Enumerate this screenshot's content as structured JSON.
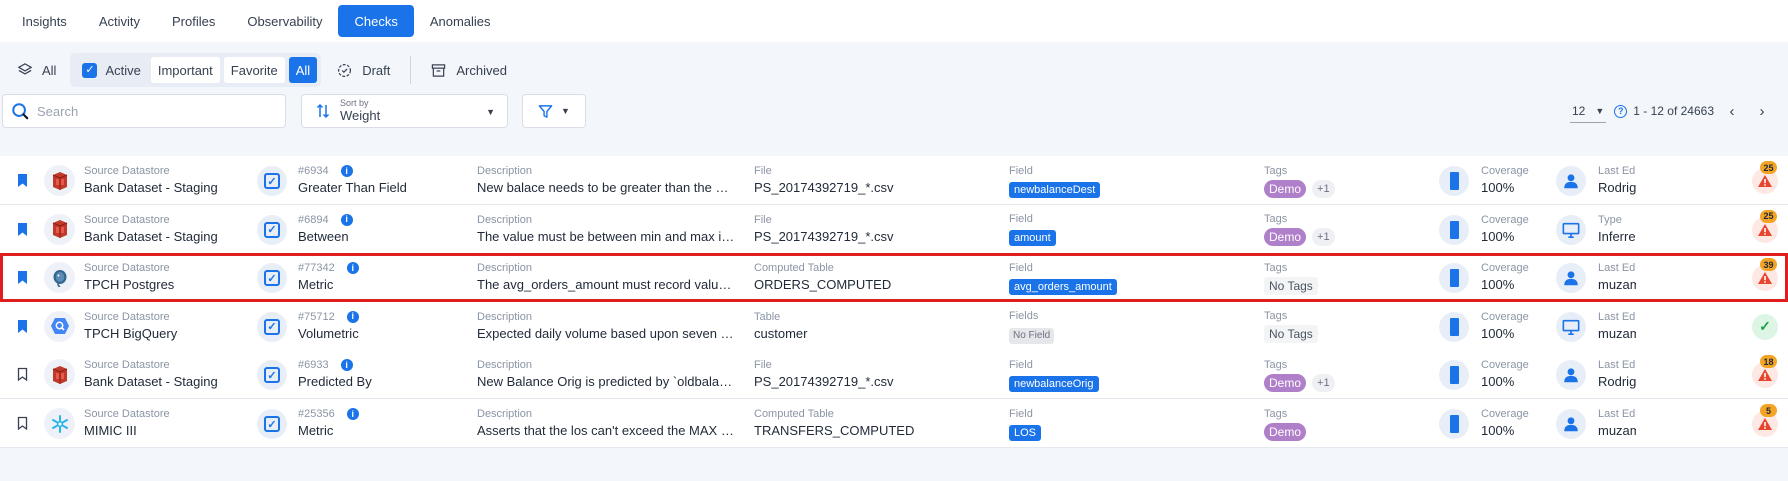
{
  "tabs": [
    {
      "label": "Insights",
      "active": false
    },
    {
      "label": "Activity",
      "active": false
    },
    {
      "label": "Profiles",
      "active": false
    },
    {
      "label": "Observability",
      "active": false
    },
    {
      "label": "Checks",
      "active": true
    },
    {
      "label": "Anomalies",
      "active": false
    }
  ],
  "status_filter": {
    "all_label": "All",
    "active_label": "Active",
    "active_checked": true,
    "important_label": "Important",
    "favorite_label": "Favorite",
    "all_sub_label": "All",
    "draft_label": "Draft",
    "archived_label": "Archived"
  },
  "search": {
    "placeholder": "Search",
    "value": ""
  },
  "sort": {
    "label": "Sort by",
    "value": "Weight"
  },
  "pagination": {
    "per_page": "12",
    "range_text": "1 - 12 of 24663"
  },
  "colors": {
    "accent": "#1a73e8",
    "tag": "#b07fc9",
    "highlight": "#e01e1e",
    "anomaly_badge": "#f4a425",
    "anomaly_alert": "#e8452c",
    "passing": "#1fa34a"
  },
  "rows": [
    {
      "bookmarked": true,
      "highlighted": false,
      "datastore_icon": "red-database-icon",
      "datastore_label": "Source Datastore",
      "datastore": "Bank Dataset - Staging",
      "check_id": "#6934",
      "check_type": "Greater Than Field",
      "desc_label": "Description",
      "description": "New balace needs to be greater than the old b...",
      "container_label": "File",
      "container": "PS_20174392719_*.csv",
      "field_label": "Field",
      "field": "newbalanceDest",
      "field_chip": true,
      "tags_label": "Tags",
      "tag": "Demo",
      "tag_more": "+1",
      "has_tag": true,
      "coverage_label": "Coverage",
      "coverage": "100%",
      "edit_label": "Last Edit",
      "editor": "Rodrigo",
      "editor_icon": "user-icon",
      "anomaly_count": "25",
      "anomaly_state": "alert"
    },
    {
      "bookmarked": true,
      "highlighted": false,
      "datastore_icon": "red-database-icon",
      "datastore_label": "Source Datastore",
      "datastore": "Bank Dataset - Staging",
      "check_id": "#6894",
      "check_type": "Between",
      "desc_label": "Description",
      "description": "The value must be between min and max inclu...",
      "container_label": "File",
      "container": "PS_20174392719_*.csv",
      "field_label": "Field",
      "field": "amount",
      "field_chip": true,
      "tags_label": "Tags",
      "tag": "Demo",
      "tag_more": "+1",
      "has_tag": true,
      "coverage_label": "Coverage",
      "coverage": "100%",
      "edit_label": "Type",
      "editor": "Inferred",
      "editor_icon": "monitor-icon",
      "anomaly_count": "25",
      "anomaly_state": "alert"
    },
    {
      "bookmarked": true,
      "highlighted": true,
      "datastore_icon": "postgres-icon",
      "datastore_label": "Source Datastore",
      "datastore": "TPCH Postgres",
      "check_id": "#77342",
      "check_type": "Metric",
      "desc_label": "Description",
      "description": "The avg_orders_amount must record values d...",
      "container_label": "Computed Table",
      "container": "ORDERS_COMPUTED",
      "field_label": "Field",
      "field": "avg_orders_amount",
      "field_chip": true,
      "tags_label": "Tags",
      "tag": "No Tags",
      "tag_more": "",
      "has_tag": false,
      "coverage_label": "Coverage",
      "coverage": "100%",
      "edit_label": "Last Edit",
      "editor": "muzammil",
      "editor_icon": "user-icon",
      "anomaly_count": "39",
      "anomaly_state": "alert"
    },
    {
      "bookmarked": true,
      "highlighted": false,
      "datastore_icon": "bigquery-icon",
      "datastore_label": "Source Datastore",
      "datastore": "TPCH BigQuery",
      "check_id": "#75712",
      "check_type": "Volumetric",
      "desc_label": "Description",
      "description": "Expected daily volume based upon seven day ...",
      "container_label": "Table",
      "container": "customer",
      "field_label": "Fields",
      "field": "No Field",
      "field_chip": false,
      "tags_label": "Tags",
      "tag": "No Tags",
      "tag_more": "",
      "has_tag": false,
      "coverage_label": "Coverage",
      "coverage": "100%",
      "edit_label": "Last Edit",
      "editor": "muzammil",
      "editor_icon": "monitor-icon",
      "anomaly_count": "",
      "anomaly_state": "ok"
    },
    {
      "bookmarked": false,
      "highlighted": false,
      "datastore_icon": "red-database-icon",
      "datastore_label": "Source Datastore",
      "datastore": "Bank Dataset - Staging",
      "check_id": "#6933",
      "check_type": "Predicted By",
      "desc_label": "Description",
      "description": "New Balance Orig is predicted by `oldbalance...",
      "container_label": "File",
      "container": "PS_20174392719_*.csv",
      "field_label": "Field",
      "field": "newbalanceOrig",
      "field_chip": true,
      "tags_label": "Tags",
      "tag": "Demo",
      "tag_more": "+1",
      "has_tag": true,
      "coverage_label": "Coverage",
      "coverage": "100%",
      "edit_label": "Last Edit",
      "editor": "Rodrigo",
      "editor_icon": "user-icon",
      "anomaly_count": "18",
      "anomaly_state": "alert"
    },
    {
      "bookmarked": false,
      "highlighted": false,
      "datastore_icon": "snowflake-icon",
      "datastore_label": "Source Datastore",
      "datastore": "MIMIC III",
      "check_id": "#25356",
      "check_type": "Metric",
      "desc_label": "Description",
      "description": "Asserts that the los can't exceed the MAX valu...",
      "container_label": "Computed Table",
      "container": "TRANSFERS_COMPUTED",
      "field_label": "Field",
      "field": "LOS",
      "field_chip": true,
      "tags_label": "Tags",
      "tag": "Demo",
      "tag_more": "",
      "has_tag": true,
      "coverage_label": "Coverage",
      "coverage": "100%",
      "edit_label": "Last Edit",
      "editor": "muzammil",
      "editor_icon": "user-icon",
      "anomaly_count": "5",
      "anomaly_state": "alert"
    }
  ]
}
